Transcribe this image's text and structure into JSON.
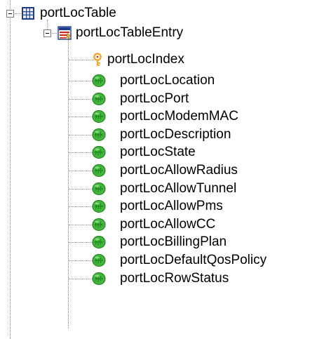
{
  "tree": {
    "table": {
      "label": "portLocTable",
      "icon": "table-icon",
      "expanded": true
    },
    "entry": {
      "label": "portLocTableEntry",
      "icon": "table-entry-icon",
      "expanded": true
    },
    "index": {
      "label": "portLocIndex",
      "icon": "key-icon"
    },
    "leaves": [
      {
        "label": "portLocLocation",
        "icon": "leaf-icon"
      },
      {
        "label": "portLocPort",
        "icon": "leaf-icon"
      },
      {
        "label": "portLocModemMAC",
        "icon": "leaf-icon"
      },
      {
        "label": "portLocDescription",
        "icon": "leaf-icon"
      },
      {
        "label": "portLocState",
        "icon": "leaf-icon"
      },
      {
        "label": "portLocAllowRadius",
        "icon": "leaf-icon"
      },
      {
        "label": "portLocAllowTunnel",
        "icon": "leaf-icon"
      },
      {
        "label": "portLocAllowPms",
        "icon": "leaf-icon"
      },
      {
        "label": "portLocAllowCC",
        "icon": "leaf-icon"
      },
      {
        "label": "portLocBillingPlan",
        "icon": "leaf-icon"
      },
      {
        "label": "portLocDefaultQosPolicy",
        "icon": "leaf-icon"
      },
      {
        "label": "portLocRowStatus",
        "icon": "leaf-icon"
      }
    ],
    "colors": {
      "leaf": "#3fb53a",
      "key": "#f2a72a",
      "table": "#1f3c8a",
      "entry_red": "#cc2a1a"
    }
  }
}
